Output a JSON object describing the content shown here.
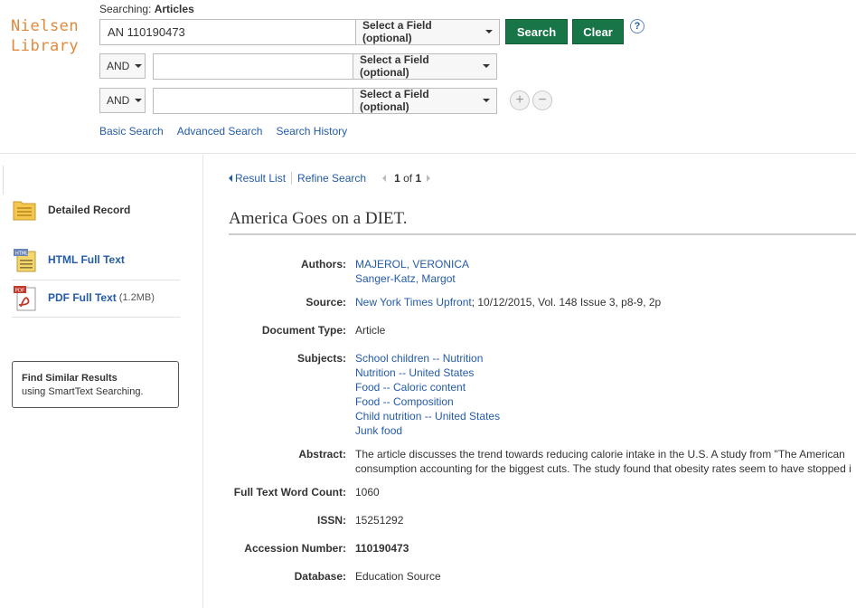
{
  "logo": {
    "line1": "Nielsen",
    "line2": "Library"
  },
  "search": {
    "searching_prefix": "Searching:",
    "searching_db": "Articles",
    "main_query": "AN 110190473",
    "field_placeholder": "Select a Field (optional)",
    "bool_op": "AND",
    "search_button": "Search",
    "clear_button": "Clear",
    "help": "?",
    "add": "+",
    "remove": "−"
  },
  "search_links": [
    "Basic Search",
    "Advanced Search",
    "Search History"
  ],
  "sidebar": {
    "detailed_record": "Detailed Record",
    "html_full_text": "HTML Full Text",
    "pdf_full_text": "PDF Full Text",
    "pdf_size": "(1.2MB)",
    "find_similar_title": "Find Similar Results",
    "find_similar_sub": "using SmartText Searching."
  },
  "nav": {
    "result_list": "Result List",
    "refine_search": "Refine Search",
    "page_current": "1",
    "page_of": "of",
    "page_total": "1"
  },
  "record": {
    "title": "America Goes on a DIET.",
    "fields": {
      "authors_label": "Authors:",
      "authors": [
        "MAJEROL, VERONICA",
        "Sanger-Katz, Margot"
      ],
      "source_label": "Source:",
      "source_link": "New York Times Upfront",
      "source_rest": "; 10/12/2015, Vol. 148 Issue 3, p8-9, 2p",
      "doctype_label": "Document Type:",
      "doctype": "Article",
      "subjects_label": "Subjects:",
      "subjects": [
        "School children -- Nutrition",
        "Nutrition -- United States",
        "Food -- Caloric content",
        "Food -- Composition",
        "Child nutrition -- United States",
        "Junk food"
      ],
      "abstract_label": "Abstract:",
      "abstract_line1": "The article discusses the trend towards reducing calorie intake in the U.S. A study from \"The American",
      "abstract_line2": "consumption accounting for the biggest cuts. The study found that obesity rates seem to have stopped i",
      "wordcount_label": "Full Text Word Count:",
      "wordcount": "1060",
      "issn_label": "ISSN:",
      "issn": "15251292",
      "accession_label": "Accession Number:",
      "accession": "110190473",
      "database_label": "Database:",
      "database": "Education Source"
    }
  }
}
